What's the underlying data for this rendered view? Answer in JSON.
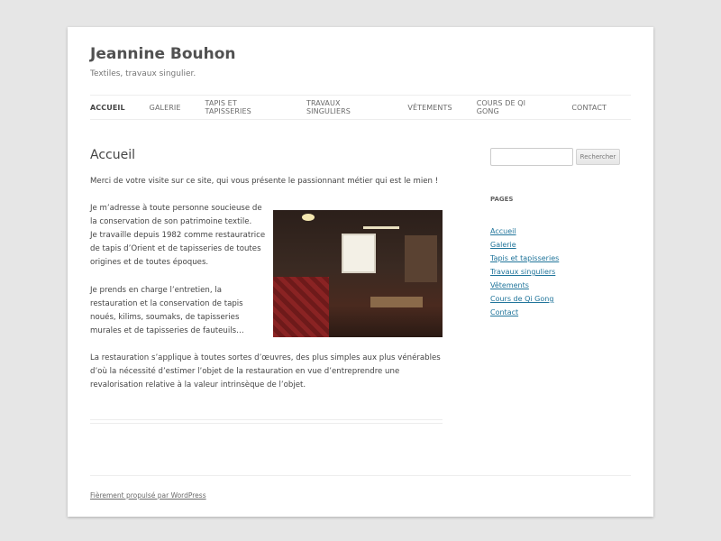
{
  "site": {
    "title": "Jeannine Bouhon",
    "description": "Textiles, travaux singulier."
  },
  "nav": {
    "items": [
      {
        "label": "Accueil"
      },
      {
        "label": "Galerie"
      },
      {
        "label": "Tapis et tapisseries"
      },
      {
        "label": "Travaux singuliers"
      },
      {
        "label": "Vêtements"
      },
      {
        "label": "Cours de Qi Gong"
      },
      {
        "label": "Contact"
      }
    ],
    "current": "Accueil"
  },
  "entry": {
    "title": "Accueil",
    "intro": "Merci de votre visite sur ce site, qui vous présente le passionnant métier qui est le mien !",
    "para1_line1": "Je m’adresse à toute personne soucieuse de la conservation de son patrimoine textile.",
    "para1_line2": "Je travaille depuis 1982 comme restauratrice de tapis d’Orient et de tapisseries de toutes origines et de toutes époques.",
    "para2": "Je prends en charge l’entretien, la restauration et la conservation de tapis noués, kilims, soumaks, de tapisseries murales et de tapisseries de fauteuils…",
    "para3": "La restauration s’applique à toutes sortes d’œuvres, des plus simples aux plus vénérables d’où la nécessité d’estimer l’objet de la restauration en vue d’entreprendre une revalorisation relative à la valeur intrinsèque de l’objet."
  },
  "sidebar": {
    "search": {
      "placeholder": "",
      "button_label": "Rechercher"
    },
    "pages_title": "Pages",
    "pages": [
      {
        "label": "Accueil"
      },
      {
        "label": "Galerie"
      },
      {
        "label": "Tapis et tapisseries"
      },
      {
        "label": "Travaux singuliers"
      },
      {
        "label": "Vêtements"
      },
      {
        "label": "Cours de Qi Gong"
      },
      {
        "label": "Contact"
      }
    ]
  },
  "footer": {
    "credit": "Fièrement propulsé par WordPress"
  },
  "colors": {
    "background": "#e6e6e6",
    "link": "#21759b",
    "text": "#444444"
  }
}
